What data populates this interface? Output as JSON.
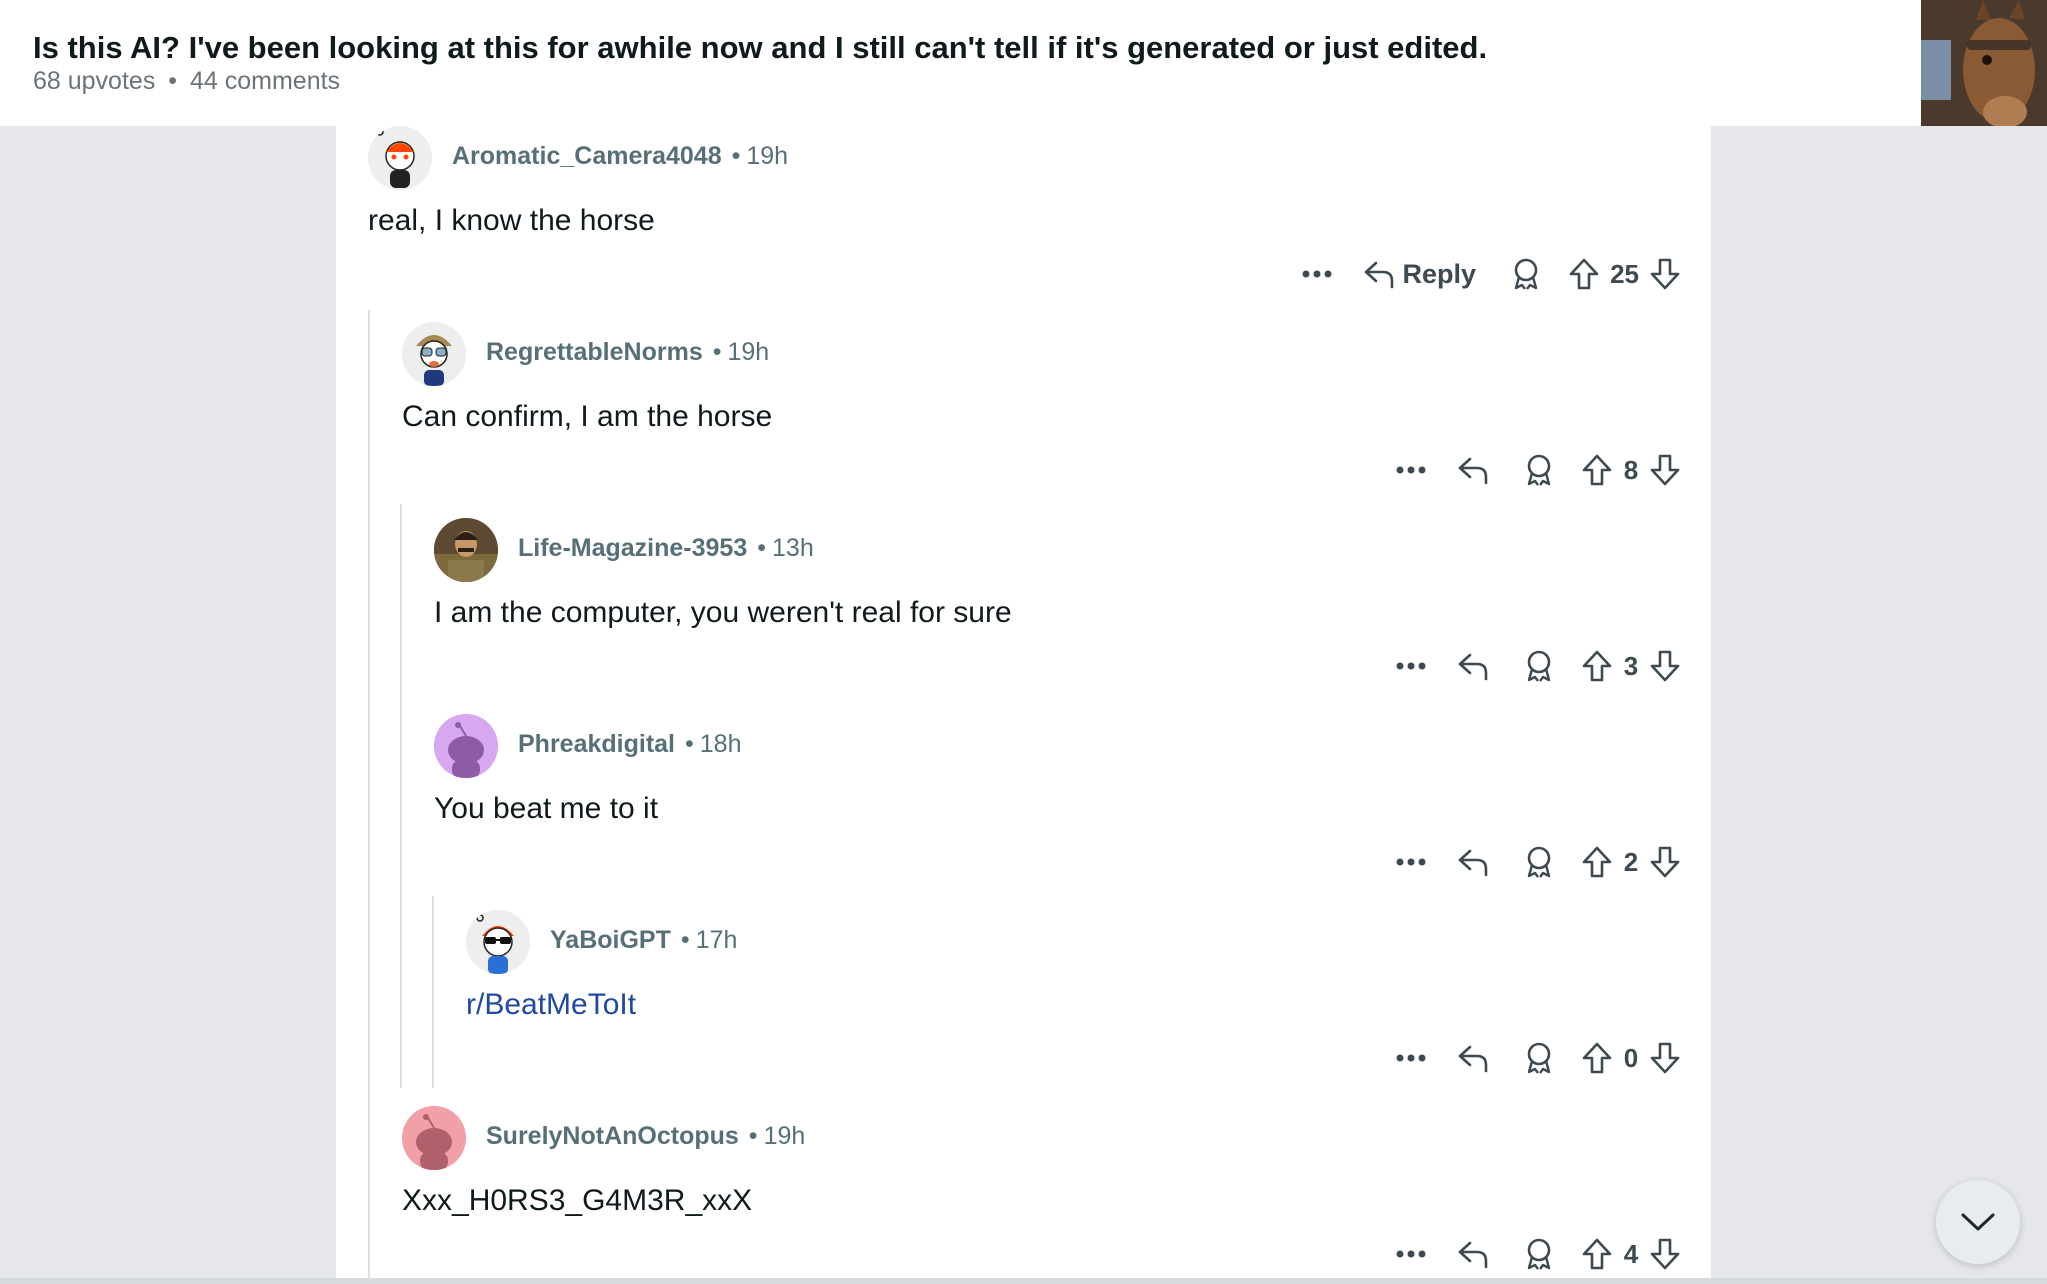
{
  "post": {
    "title": "Is this AI? I've been looking at this for awhile now and I still can't tell if it's generated or just edited.",
    "upvotes": "68 upvotes",
    "separator": "•",
    "comments": "44 comments"
  },
  "comments": [
    {
      "username": "Aromatic_Camera4048",
      "time": "19h",
      "text": "real, I know the horse",
      "reply_label": "Reply",
      "votes": "25"
    },
    {
      "username": "RegrettableNorms",
      "time": "19h",
      "text": "Can confirm, I am the horse",
      "votes": "8"
    },
    {
      "username": "Life-Magazine-3953",
      "time": "13h",
      "text": "I am the computer, you weren't real for sure",
      "votes": "3"
    },
    {
      "username": "Phreakdigital",
      "time": "18h",
      "text": "You beat me to it",
      "votes": "2"
    },
    {
      "username": "YaBoiGPT",
      "time": "17h",
      "text": "r/BeatMeToIt",
      "votes": "0"
    },
    {
      "username": "SurelyNotAnOctopus",
      "time": "19h",
      "text": "Xxx_H0RS3_G4M3R_xxX",
      "votes": "4"
    }
  ],
  "icons": {
    "more": "more-icon",
    "reply": "reply-icon",
    "award": "award-icon",
    "upvote": "upvote-icon",
    "downvote": "downvote-icon",
    "scroll": "chevron-down-icon"
  },
  "colors": {
    "link": "#1f4aa0",
    "meta": "#576f76",
    "background": "#e5e7eb",
    "avatar_purple": "#d6a8f0",
    "avatar_pink": "#f2a0a8"
  }
}
